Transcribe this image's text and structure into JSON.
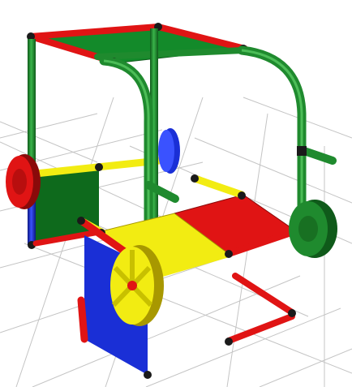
{
  "scene": {
    "subject": "play-structure-3d-render",
    "colors": {
      "background": "#ffffff",
      "grid": "#bdbdbd",
      "green": "#1f8a2e",
      "green_dark": "#0f5a1a",
      "red": "#e01414",
      "red_dark": "#8a0a0a",
      "blue": "#1a2fd6",
      "blue_dark": "#0b1680",
      "yellow": "#f2ec12",
      "yellow_dark": "#b8a800",
      "joint": "#1a1a1a"
    }
  }
}
